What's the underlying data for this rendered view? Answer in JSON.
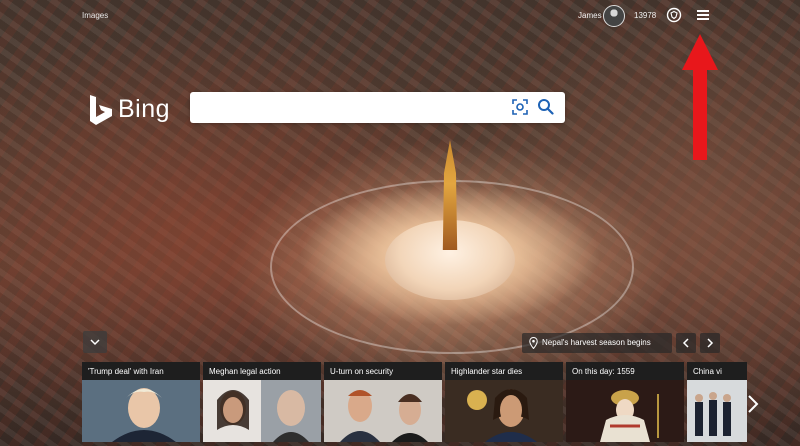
{
  "header": {
    "images_link": "Images",
    "user_name": "James",
    "reward_points": "13978"
  },
  "logo": {
    "text": "Bing"
  },
  "search": {
    "value": "",
    "placeholder": ""
  },
  "caption": {
    "text": "Nepal's harvest season begins"
  },
  "news": [
    {
      "title": "'Trump deal' with Iran"
    },
    {
      "title": "Meghan legal action"
    },
    {
      "title": "U-turn on security"
    },
    {
      "title": "Highlander star dies"
    },
    {
      "title": "On this day: 1559"
    },
    {
      "title": "China vi"
    }
  ],
  "colors": {
    "annotation_arrow": "#e8171b",
    "accent": "#1e62b5"
  }
}
